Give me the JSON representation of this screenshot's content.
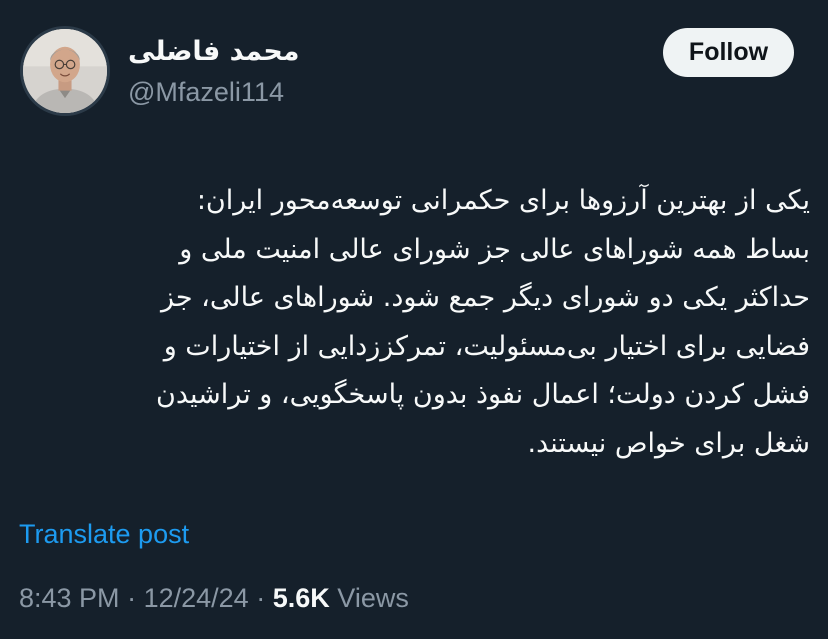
{
  "author": {
    "display_name": "محمد فاضلی",
    "handle": "@Mfazeli114"
  },
  "follow_button": {
    "label": "Follow"
  },
  "tweet": {
    "text": "یکی از بهترین آرزوها برای حکمرانی توسعه‌محور ایران:\nبساط همه شوراهای عالی جز شورای عالی امنیت ملی و\nحداکثر یکی دو شورای دیگر جمع شود. شوراهای عالی، جز\nفضایی برای اختیار بی‌مسئولیت، تمرکززدایی از اختیارات و\nفشل کردن دولت؛ اعمال نفوذ بدون پاسخگویی، و تراشیدن\nشغل برای خواص نیستند."
  },
  "translate": {
    "label": "Translate post"
  },
  "meta": {
    "time": "8:43 PM",
    "separator": "·",
    "date": "12/24/24",
    "views_count": "5.6K",
    "views_label": "Views"
  },
  "colors": {
    "background": "#15202b",
    "text_primary": "#f7f9f9",
    "text_secondary": "#8b98a5",
    "link": "#1d9bf0",
    "button_bg": "#eff3f4",
    "button_text": "#0f1419"
  },
  "icons": {
    "avatar": "profile-photo"
  }
}
